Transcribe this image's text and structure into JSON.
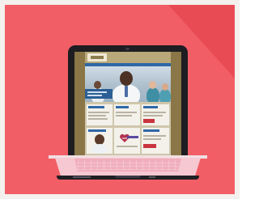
{
  "scene": {
    "description_none": "",
    "colors": {
      "background": "#f25e66",
      "diagonal_shadow": "#e84852",
      "frame": "#f3f0ee",
      "laptop_lid": "#1d1d22",
      "laptop_base": "#f6c8d1",
      "site_accent": "#2f67a6"
    }
  },
  "icons": {
    "laptop": "laptop-icon",
    "webcam": "webcam-icon"
  }
}
